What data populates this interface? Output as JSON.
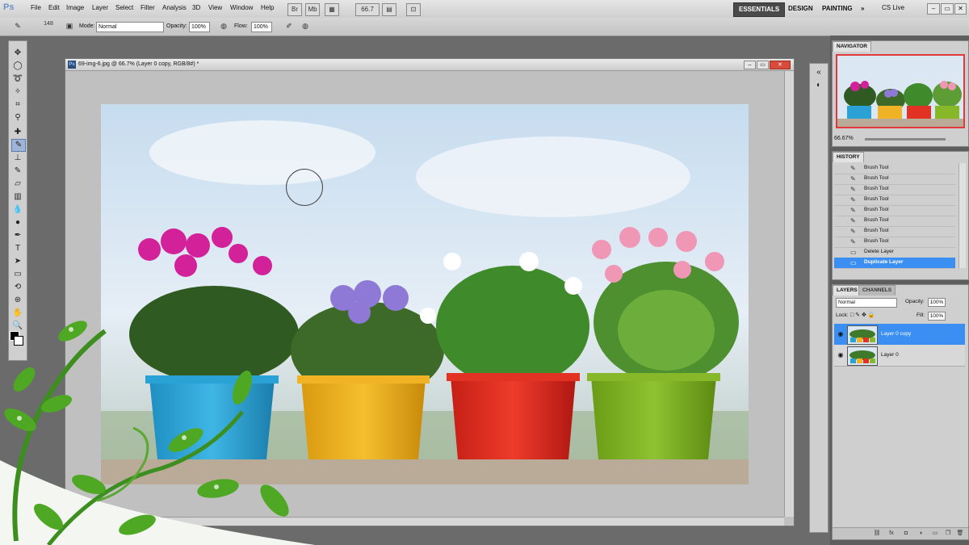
{
  "app": {
    "logo": "Ps"
  },
  "menu": [
    "File",
    "Edit",
    "Image",
    "Layer",
    "Select",
    "Filter",
    "Analysis",
    "3D",
    "View",
    "Window",
    "Help"
  ],
  "zoom_box": "66.7",
  "workspaces": {
    "essentials": "ESSENTIALS",
    "design": "DESIGN",
    "painting": "PAINTING",
    "more": "»",
    "cslive": "CS Live"
  },
  "options": {
    "brush_size": "148",
    "mode_label": "Mode:",
    "mode_value": "Normal",
    "opacity_label": "Opacity:",
    "opacity_value": "100%",
    "flow_label": "Flow:",
    "flow_value": "100%"
  },
  "document": {
    "title": "69-img-6.jpg @ 66.7% (Layer 0 copy, RGB/8#) *"
  },
  "navigator": {
    "tab": "NAVIGATOR",
    "zoom": "66.67%"
  },
  "history": {
    "tab": "HISTORY",
    "items": [
      "Brush Tool",
      "Brush Tool",
      "Brush Tool",
      "Brush Tool",
      "Brush Tool",
      "Brush Tool",
      "Brush Tool",
      "Brush Tool",
      "Delete Layer",
      "Duplicate Layer"
    ]
  },
  "layers": {
    "tab_layers": "LAYERS",
    "tab_channels": "CHANNELS",
    "blend_mode": "Normal",
    "opacity_label": "Opacity:",
    "opacity_value": "100%",
    "lock_label": "Lock:",
    "fill_label": "Fill:",
    "fill_value": "100%",
    "items": [
      "Layer 0 copy",
      "Layer 0"
    ]
  },
  "colors": {
    "accent": "#3b8ff2",
    "nav_frame": "#e23a3a"
  }
}
